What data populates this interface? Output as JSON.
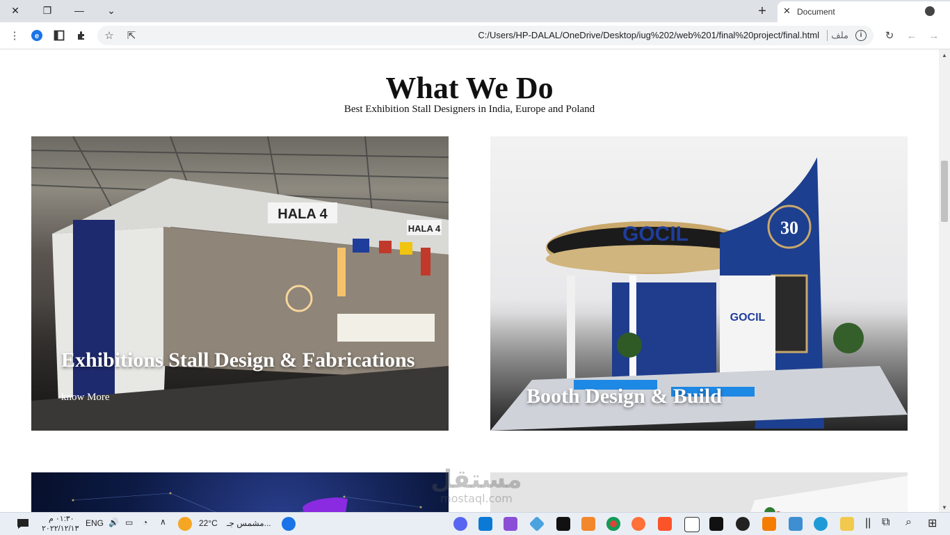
{
  "browser": {
    "tab_title": "Document",
    "url": "C:/Users/HP-DALAL/OneDrive/Desktop/iug%202/web%201/final%20project/final.html",
    "site_label": "ملف",
    "info_glyph": "i"
  },
  "page": {
    "heading": "What We Do",
    "subheading": "Best Exhibition Stall Designers in India, Europe and Poland",
    "cards": [
      {
        "title": "Exhibitions Stall Design & Fabrications",
        "link": "know More"
      },
      {
        "title": "Booth Design & Build"
      }
    ]
  },
  "watermark": {
    "arabic": "مستقل",
    "latin": "mostaql.com"
  },
  "taskbar": {
    "time": "٠١:٣٠ م",
    "date": "٢٠٢٢/١٢/١٣",
    "language": "ENG",
    "temperature": "22°C",
    "weather": "مشمس جـ..."
  },
  "icons": {
    "colors": {
      "vscode": "#0a7ad6",
      "visual_studio": "#8a4fd6",
      "intellij": "#111111",
      "sublime": "#f3872b",
      "chrome": "#db4437",
      "firefox": "#ff7139",
      "brave": "#fb542b",
      "edge": "#1e9bd7",
      "explorer": "#f2c94c",
      "discord": "#5865f2"
    }
  }
}
